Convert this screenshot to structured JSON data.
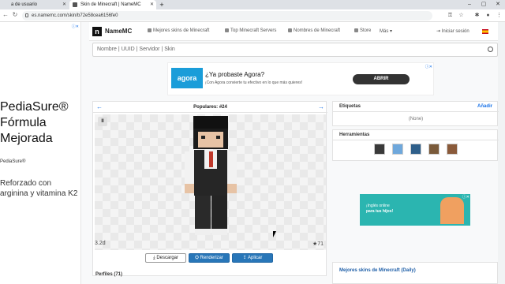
{
  "browser": {
    "tabs": [
      {
        "label": "a de usuario"
      },
      {
        "label": "Skin de Minecraft | NameMC"
      }
    ],
    "new_tab": "+",
    "url": "es.namemc.com/skin/b72e58cea6156fe0",
    "window_controls": {
      "minimize": "–",
      "restore": "▢",
      "close": "✕"
    }
  },
  "left_ad": {
    "badge": "ⓘ✕",
    "headline": "PediaSure® Fórmula Mejorada",
    "small": "PediaSure®",
    "body": "Reforzado con arginina y vitamina K2"
  },
  "navbar": {
    "logo": "n",
    "brand": "NameMC",
    "links": [
      {
        "label": "Mejores skins de Minecraft"
      },
      {
        "label": "Top Minecraft Servers"
      },
      {
        "label": "Nombres de Minecraft"
      },
      {
        "label": "Store"
      },
      {
        "label": "Más ▾"
      }
    ],
    "login": "⇥ Iniciar sesión"
  },
  "search": {
    "placeholder": "Nombre | UUID | Servidor | Skin"
  },
  "banner": {
    "logo": "agora",
    "title": "¿Ya probaste Agora?",
    "subtitle": "¡Con Agora convierte tu efectivo en lo que más quieres!",
    "cta": "ABRIR",
    "badge": "ⓘ✕"
  },
  "skin": {
    "prev": "←",
    "next": "→",
    "title": "Populares: #24",
    "pause": "II",
    "age": "3.2d",
    "stars": "★71",
    "download": "⤓ Descargar",
    "render": "⛭ Renderizar",
    "apply": "⇪ Aplicar"
  },
  "profiles": {
    "label": "Perfiles (71)"
  },
  "tags": {
    "title": "Etiquetas",
    "add": "Añadir",
    "none": "(None)"
  },
  "tools": {
    "title": "Herramientas"
  },
  "right_ad": {
    "text1": "¡Inglés online",
    "text2": "para tus hijos!",
    "badge": "ⓘ✕"
  },
  "top_skins": {
    "title": "Mejores skins de Minecraft (Daily)"
  }
}
